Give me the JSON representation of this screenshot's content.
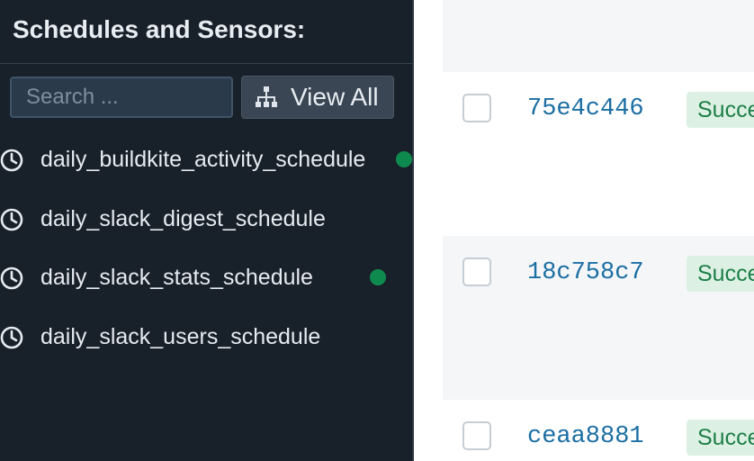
{
  "sidebar": {
    "title": "Schedules and Sensors:",
    "search": {
      "placeholder": "Search ...",
      "value": ""
    },
    "view_all_label": "View All",
    "items": [
      {
        "label": "daily_buildkite_activity_schedule",
        "icon": "clock-icon",
        "status": "running",
        "status_color": "#0f8a4f"
      },
      {
        "label": "daily_slack_digest_schedule",
        "icon": "clock-icon",
        "status": "",
        "status_color": ""
      },
      {
        "label": "daily_slack_stats_schedule",
        "icon": "clock-icon",
        "status": "running",
        "status_color": "#0f8a4f"
      },
      {
        "label": "daily_slack_users_schedule",
        "icon": "clock-icon",
        "status": "",
        "status_color": ""
      }
    ]
  },
  "runs": [
    {
      "id": "75e4c446",
      "status": "Succe"
    },
    {
      "id": "18c758c7",
      "status": "Succe"
    },
    {
      "id": "ceaa8881",
      "status": "Succe"
    }
  ],
  "colors": {
    "sidebar_bg": "#18202a",
    "accent_link": "#1b6ea3",
    "success_bg": "#dcf1e4",
    "success_text": "#1d7f47"
  }
}
